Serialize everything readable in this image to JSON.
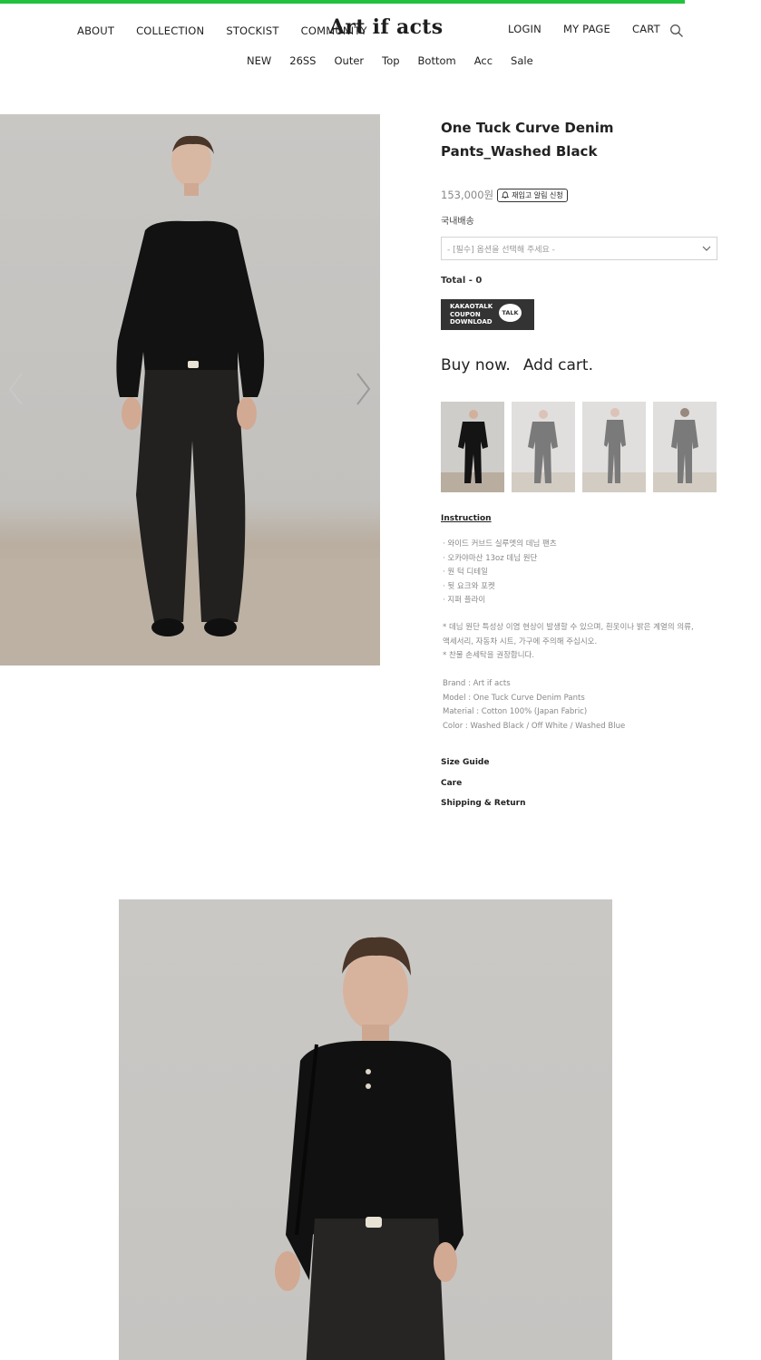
{
  "progress": {
    "percent": 90,
    "color": "#22c23f"
  },
  "header": {
    "logo": "Art if acts",
    "nav_left": [
      "ABOUT",
      "COLLECTION",
      "STOCKIST",
      "COMMUNITY"
    ],
    "nav_right": [
      "LOGIN",
      "MY PAGE",
      "CART"
    ],
    "search_icon": "search-icon"
  },
  "subnav": [
    "NEW",
    "26SS",
    "Outer",
    "Top",
    "Bottom",
    "Acc",
    "Sale"
  ],
  "product": {
    "title": "One Tuck Curve Denim Pants_Washed Black",
    "price": "153,000원",
    "restock_label": "재입고 알림 신청",
    "shipping": "국내배송",
    "option_placeholder": "- [필수] 옵션을 선택해 주세요 -",
    "total": "Total - 0",
    "kakao_lines": [
      "KAKAOTALK",
      "COUPON",
      "DOWNLOAD"
    ],
    "kakao_bubble": "TALK",
    "buy_now": "Buy now.",
    "add_cart": "Add cart."
  },
  "instruction": {
    "title": "Instruction",
    "details": [
      "· 와이드 커브드 실루엣의 데님 팬츠",
      "· 오카야마산 13oz 데님 원단",
      "· 원 턱 디테일",
      "· 뒷 요크와 포켓",
      "· 지퍼 플라이"
    ],
    "notice": [
      "* 데님 원단 특성상 이염 현상이 발생할 수 있으며, 흰옷이나 밝은 계열의 의류,",
      "액세서리, 자동차 시트, 가구에 주의해 주십시오.",
      "* 찬물 손세탁을 권장합니다."
    ],
    "specs": [
      "Brand : Art if acts",
      "Model : One Tuck Curve Denim Pants",
      "Material : Cotton 100% (Japan Fabric)",
      "Color : Washed Black / Off White / Washed Blue"
    ]
  },
  "links": [
    "Size Guide",
    "Care",
    "Shipping & Return"
  ]
}
